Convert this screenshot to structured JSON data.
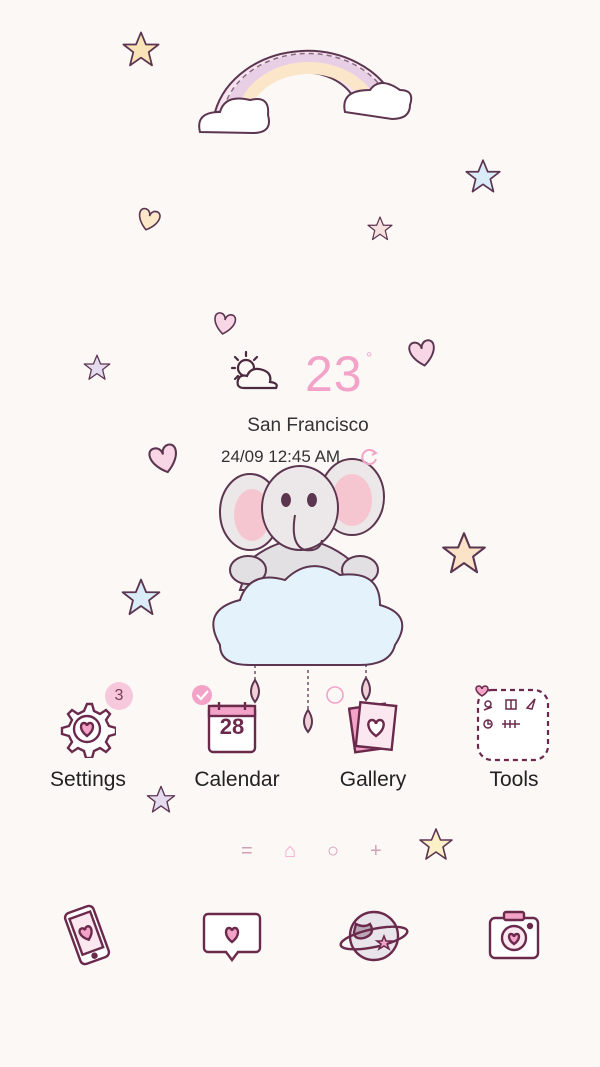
{
  "weather": {
    "icon": "partly-cloudy-icon",
    "temperature": "23",
    "degree_symbol": "°",
    "city": "San Francisco",
    "datetime": "24/09 12:45 AM",
    "refresh_icon": "refresh-icon"
  },
  "apps": [
    {
      "name": "Settings",
      "icon": "gear-heart-icon",
      "badge": "3"
    },
    {
      "name": "Calendar",
      "icon": "calendar-icon",
      "day": "28"
    },
    {
      "name": "Gallery",
      "icon": "gallery-icon"
    },
    {
      "name": "Tools",
      "icon": "tools-folder-icon"
    }
  ],
  "page_indicators": [
    {
      "symbol": "=",
      "icon": "menu-lines-icon"
    },
    {
      "symbol": "⌂",
      "icon": "home-dot-icon",
      "active": true
    },
    {
      "symbol": "○",
      "icon": "page-dot-icon"
    },
    {
      "symbol": "+",
      "icon": "add-page-icon"
    }
  ],
  "dock": [
    {
      "icon": "phone-icon"
    },
    {
      "icon": "message-icon"
    },
    {
      "icon": "internet-planet-icon"
    },
    {
      "icon": "camera-icon"
    }
  ],
  "colors": {
    "background": "#fbf8f6",
    "accent_pink": "#f3a3c8",
    "outline": "#6b2a4c",
    "star_blue": "#cfe6f7",
    "star_yellow": "#fbe3b8"
  }
}
